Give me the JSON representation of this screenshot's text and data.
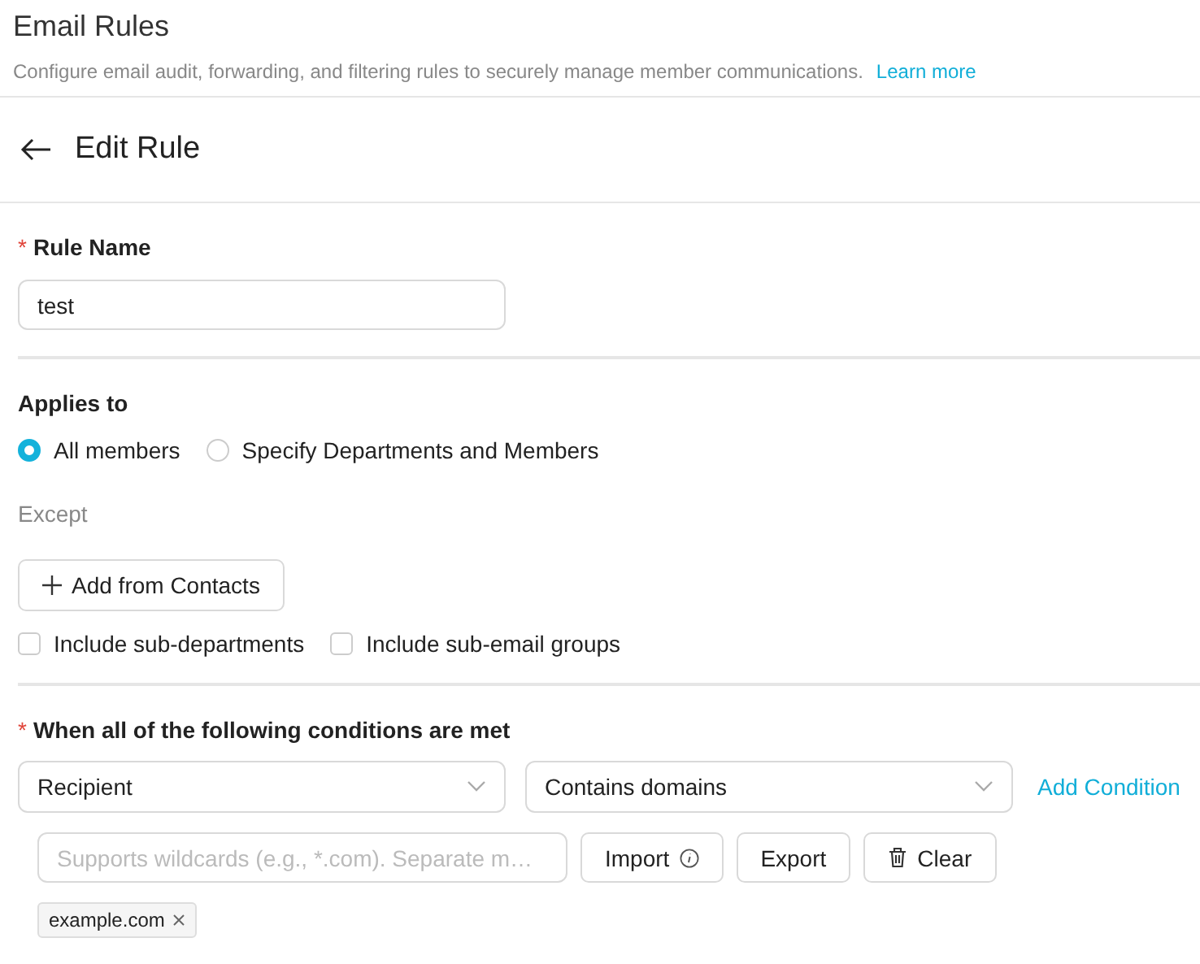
{
  "header": {
    "title": "Email Rules",
    "description": "Configure email audit, forwarding, and filtering rules to securely manage member communications.",
    "link": "Learn more"
  },
  "page_title": "Edit Rule",
  "rule_name": {
    "required_mark": "*",
    "label": "Rule Name",
    "value": "test"
  },
  "applies_to": {
    "label": "Applies to",
    "options": [
      {
        "label": "All members",
        "selected": true
      },
      {
        "label": "Specify Departments and Members",
        "selected": false
      }
    ],
    "except_label": "Except",
    "add_button": "Add from Contacts",
    "checkboxes": [
      {
        "label": "Include sub-departments",
        "checked": false
      },
      {
        "label": "Include sub-email groups",
        "checked": false
      }
    ]
  },
  "conditions": {
    "required_mark": "*",
    "label": "When all of the following conditions are met",
    "field_select": "Recipient",
    "operator_select": "Contains domains",
    "add_link": "Add Condition",
    "input": {
      "placeholder": "Supports wildcards (e.g., *.com). Separate m…"
    },
    "buttons": [
      {
        "kind": "import",
        "label": "Import"
      },
      {
        "kind": "export",
        "label": "Export"
      },
      {
        "kind": "clear",
        "label": "Clear"
      }
    ],
    "tags": [
      "example.com"
    ]
  }
}
